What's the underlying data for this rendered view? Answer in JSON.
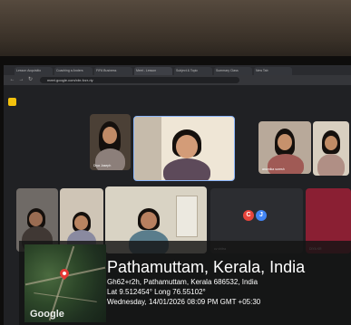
{
  "browser": {
    "tabs": [
      {
        "label": "Lesson Acquisitio"
      },
      {
        "label": "Coaching a Anders"
      },
      {
        "label": "FIFA Business"
      },
      {
        "label": "Meet - Lesson"
      },
      {
        "label": "Subject & Topic"
      },
      {
        "label": "Summary Class"
      },
      {
        "label": "New Tab"
      }
    ],
    "url": "meet.google.com/xbr-fvzr-riy"
  },
  "participants": [
    {
      "name": "Diya Joseph"
    },
    {
      "name": ""
    },
    {
      "name": "anamika suresh"
    },
    {
      "name": ""
    },
    {
      "name": ""
    },
    {
      "name": ""
    },
    {
      "name": ""
    },
    {
      "name": "cv chitra"
    },
    {
      "name": "DIYA KR"
    }
  ],
  "avatar_initials": [
    "C",
    "J"
  ],
  "location": {
    "title": "Pathamuttam, Kerala, India",
    "address": "Gh62+r2h, Pathamuttam, Kerala 686532, India",
    "coords": "Lat 9.512454° Long 76.55102°",
    "datetime": "Wednesday, 14/01/2026 08:09 PM GMT +05:30",
    "map_brand": "Google"
  }
}
